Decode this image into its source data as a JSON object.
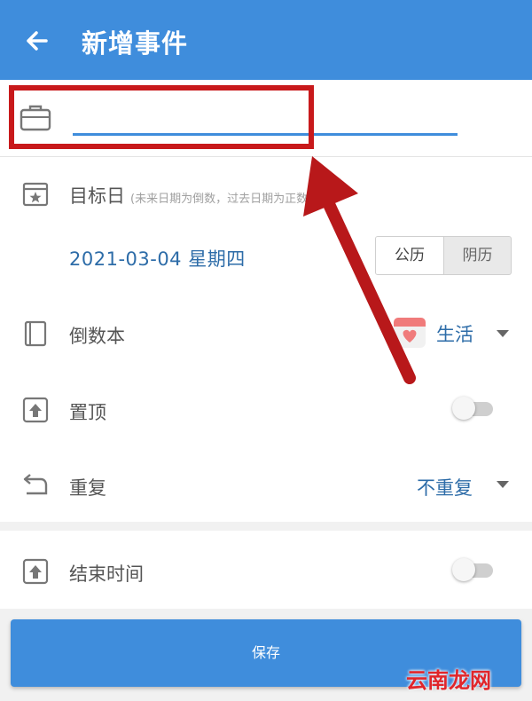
{
  "appbar": {
    "title": "新增事件",
    "back_icon": "arrow-left-icon"
  },
  "title_input": {
    "value": "",
    "placeholder": ""
  },
  "target_date": {
    "label": "目标日",
    "hint": "(未来日期为倒数，过去日期为正数)",
    "value": "2021-03-04 星期四",
    "calendar_options": [
      "公历",
      "阴历"
    ],
    "selected_calendar": "公历"
  },
  "countdown_book": {
    "label": "倒数本",
    "value": "生活",
    "badge_icon": "calendar-heart-icon"
  },
  "pin_top": {
    "label": "置顶",
    "enabled": false
  },
  "repeat": {
    "label": "重复",
    "value": "不重复"
  },
  "end_time": {
    "label": "结束时间",
    "enabled": false
  },
  "save_label": "保存",
  "watermark": "云南龙网",
  "colors": {
    "primary": "#3f8ddc",
    "value_text": "#2d6ca8",
    "annotation_red": "#c8191b"
  }
}
